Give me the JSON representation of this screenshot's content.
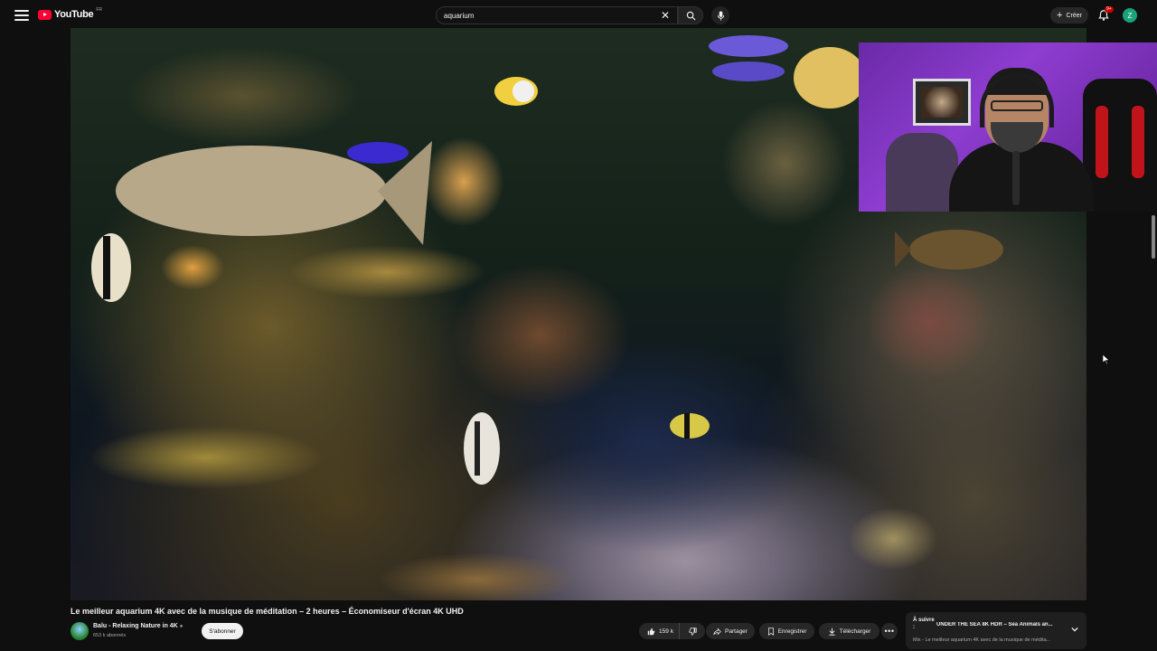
{
  "header": {
    "logo_text": "YouTube",
    "logo_sup": "FR",
    "search_value": "aquarium",
    "create_label": "Créer",
    "notification_count": "9+",
    "avatar_initial": "Z"
  },
  "video": {
    "title": "Le meilleur aquarium 4K avec de la musique de méditation – 2 heures – Économiseur d'écran 4K UHD",
    "channel_name": "Balu - Relaxing Nature in 4K",
    "channel_subs": "653 k abonnés",
    "subscribe_label": "S'abonner",
    "likes": "159 k",
    "share_label": "Partager",
    "save_label": "Enregistrer",
    "download_label": "Télécharger"
  },
  "up_next": {
    "label": "À suivre :",
    "title": "UNDER THE SEA 8K HDR – Sea Animals an...",
    "subtitle": "Mix - Le meilleur aquarium 4K avec de la musique de médita..."
  },
  "colors": {
    "background": "#0f0f0f",
    "brand_red": "#ff0033",
    "avatar": "#1aa37a"
  }
}
